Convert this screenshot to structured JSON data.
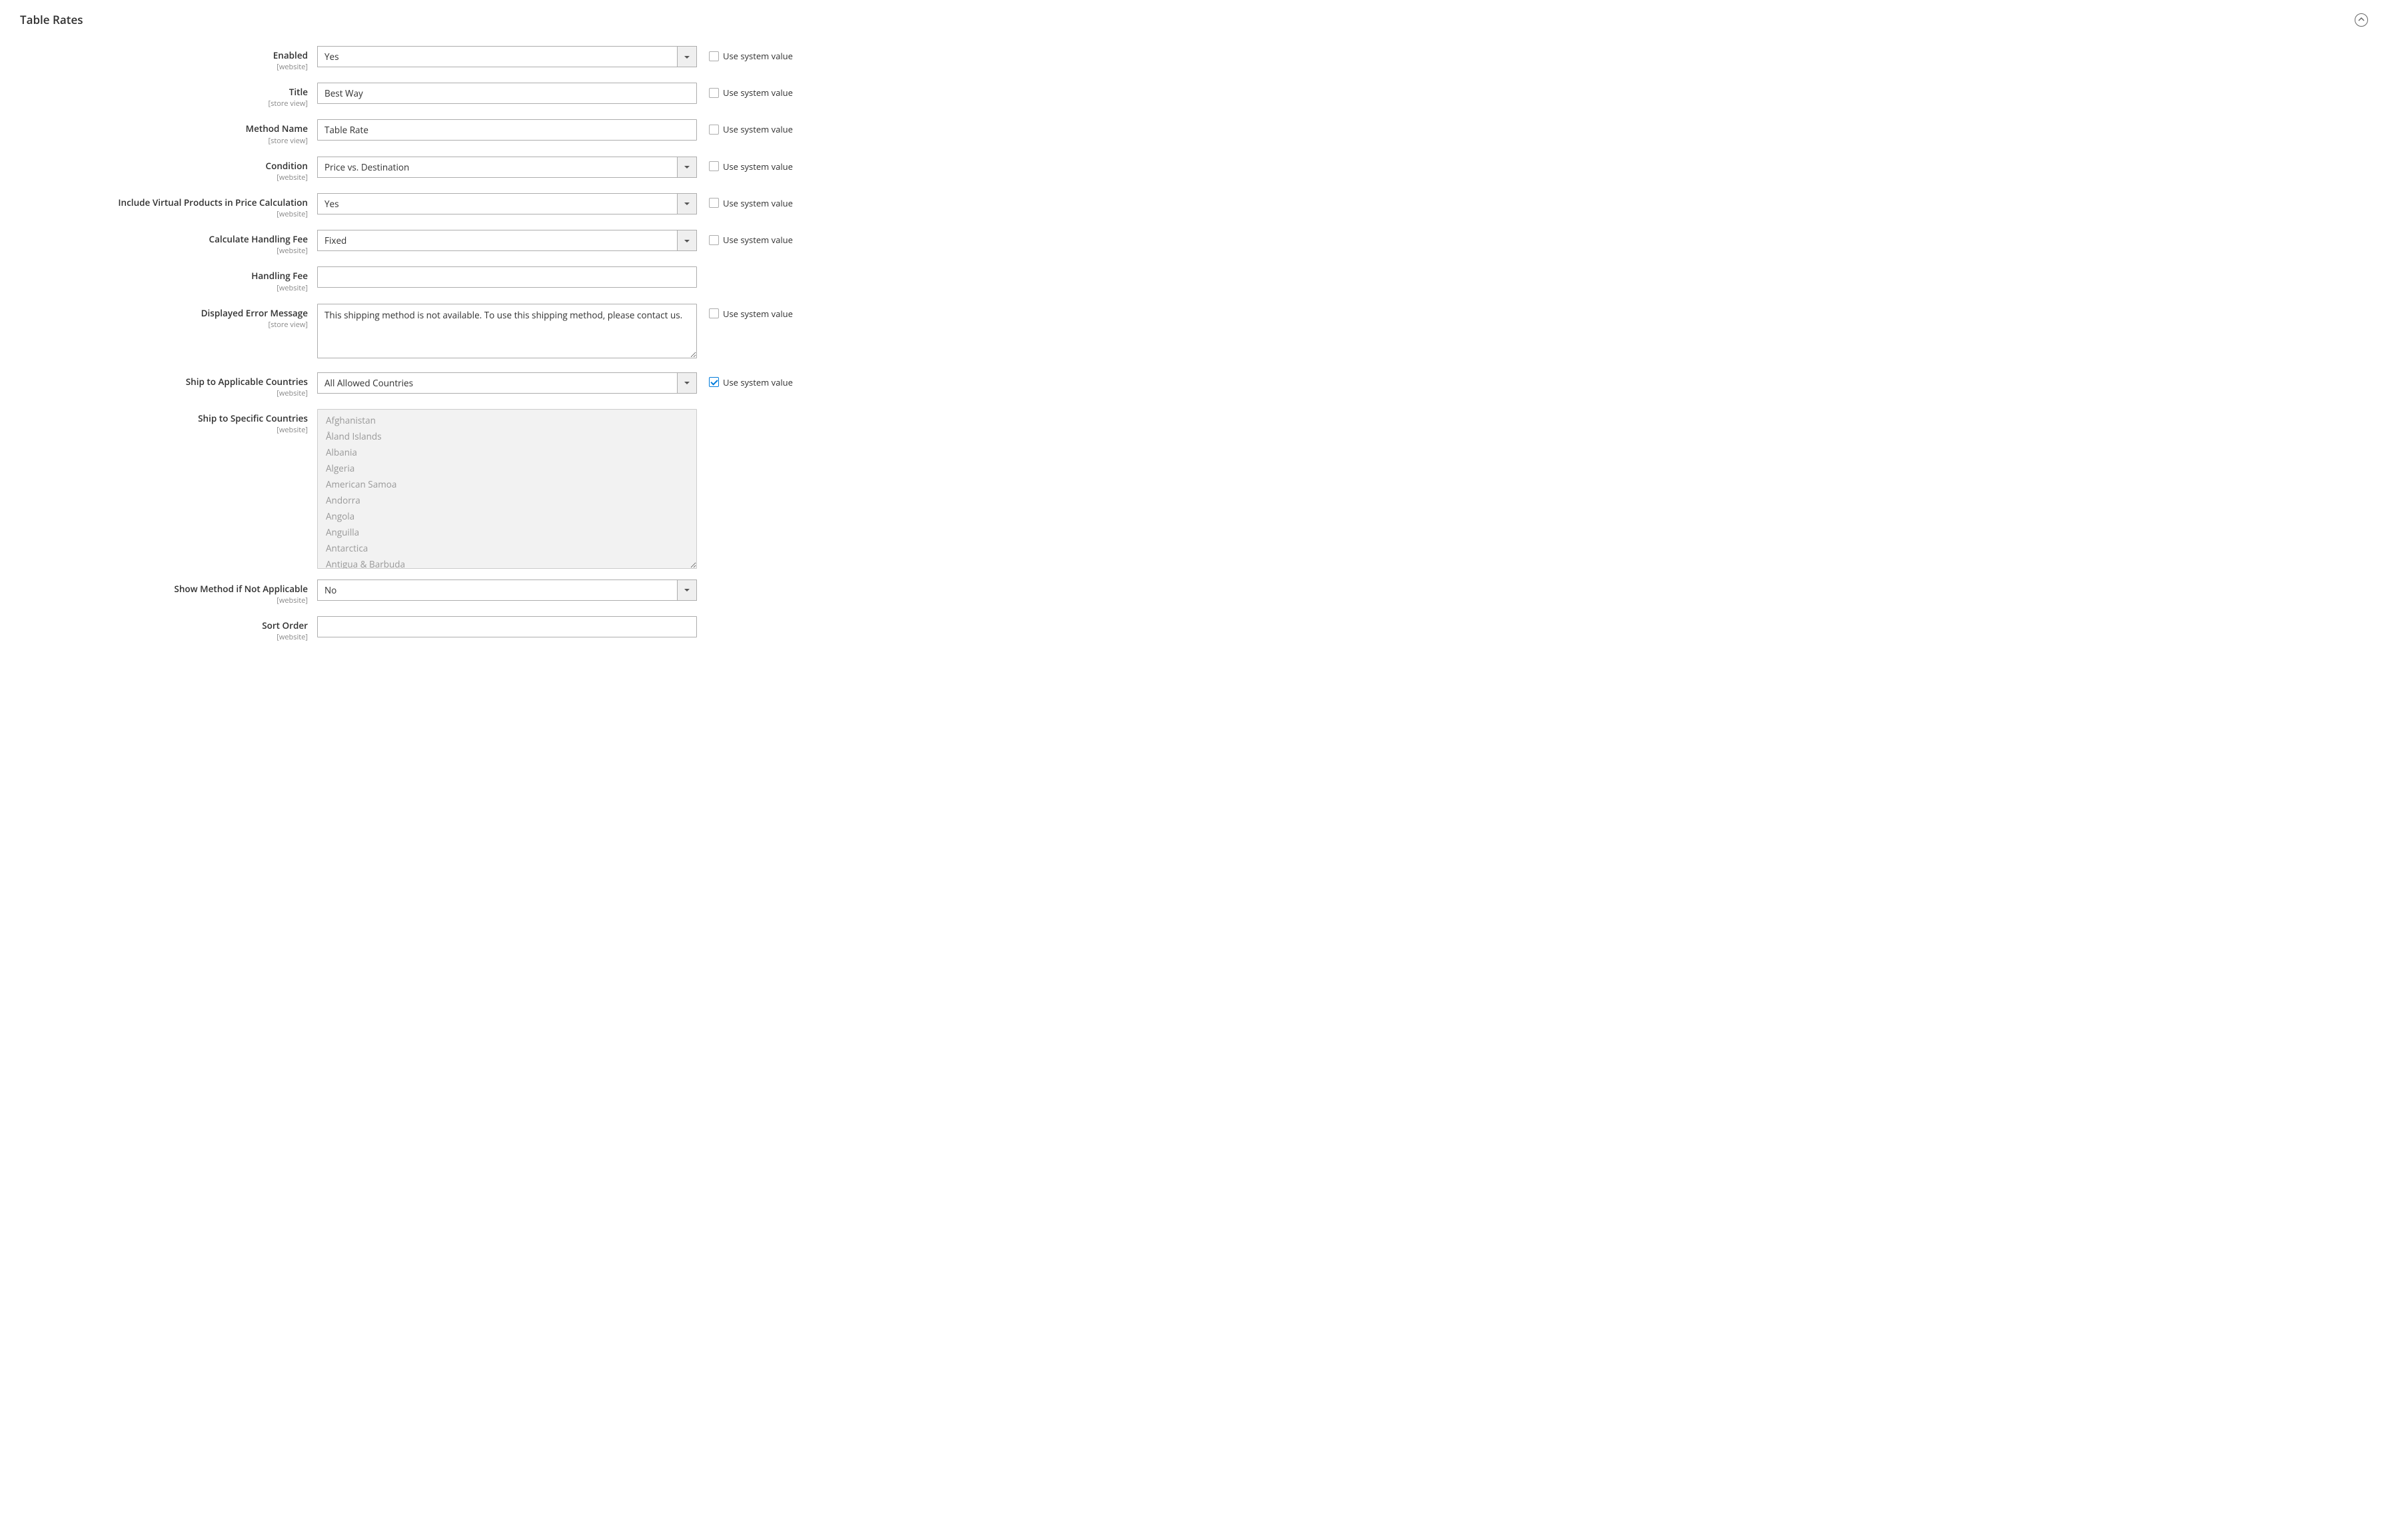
{
  "section": {
    "title": "Table Rates"
  },
  "use_system_label": "Use system value",
  "scopes": {
    "website": "[website]",
    "store_view": "[store view]"
  },
  "fields": {
    "enabled": {
      "label": "Enabled",
      "scope": "website",
      "value": "Yes",
      "use_system": false
    },
    "title": {
      "label": "Title",
      "scope": "store_view",
      "value": "Best Way",
      "use_system": false
    },
    "method_name": {
      "label": "Method Name",
      "scope": "store_view",
      "value": "Table Rate",
      "use_system": false
    },
    "condition": {
      "label": "Condition",
      "scope": "website",
      "value": "Price vs. Destination",
      "use_system": false
    },
    "include_virtual": {
      "label": "Include Virtual Products in Price Calculation",
      "scope": "website",
      "value": "Yes",
      "use_system": false
    },
    "calc_handling": {
      "label": "Calculate Handling Fee",
      "scope": "website",
      "value": "Fixed",
      "use_system": false
    },
    "handling_fee": {
      "label": "Handling Fee",
      "scope": "website",
      "value": ""
    },
    "error_msg": {
      "label": "Displayed Error Message",
      "scope": "store_view",
      "value": "This shipping method is not available. To use this shipping method, please contact us.",
      "use_system": false
    },
    "applicable": {
      "label": "Ship to Applicable Countries",
      "scope": "website",
      "value": "All Allowed Countries",
      "use_system": true
    },
    "specific": {
      "label": "Ship to Specific Countries",
      "scope": "website",
      "options": [
        "Afghanistan",
        "Åland Islands",
        "Albania",
        "Algeria",
        "American Samoa",
        "Andorra",
        "Angola",
        "Anguilla",
        "Antarctica",
        "Antigua & Barbuda"
      ]
    },
    "show_method": {
      "label": "Show Method if Not Applicable",
      "scope": "website",
      "value": "No"
    },
    "sort_order": {
      "label": "Sort Order",
      "scope": "website",
      "value": ""
    }
  }
}
